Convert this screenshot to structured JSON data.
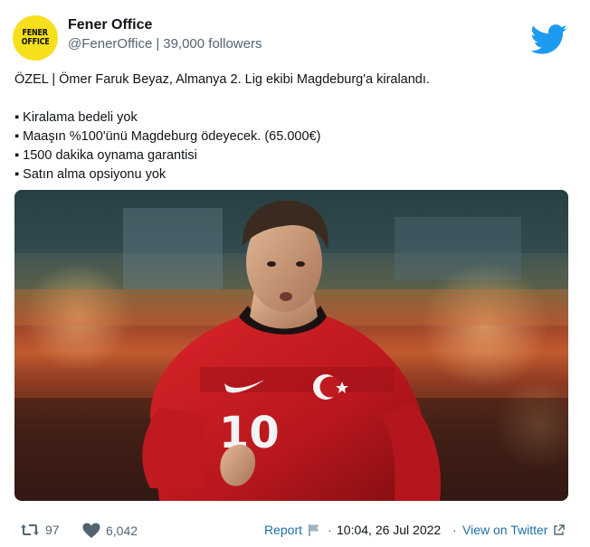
{
  "account": {
    "avatar_text_line1": "FENER",
    "avatar_text_line2": "OFFICE",
    "name": "Fener Office",
    "handle": "@FenerOffice",
    "separator": "|",
    "followers": "39,000 followers"
  },
  "tweet": {
    "headline": "ÖZEL | Ömer Faruk Beyaz, Almanya 2. Lig ekibi Magdeburg'a kiralandı.",
    "bullets": [
      "▪ Kiralama bedeli yok",
      "▪ Maaşın %100'ünü Magdeburg ödeyecek. (65.000€)",
      "▪ 1500 dakika oynama garantisi",
      "▪ Satın alma opsiyonu yok"
    ],
    "jersey_number": "10"
  },
  "footer": {
    "retweets": "97",
    "likes": "6,042",
    "report_label": "Report",
    "separator": "·",
    "timestamp": "10:04, 26 Jul 2022",
    "view_label": "View on Twitter"
  },
  "colors": {
    "accent": "#1d9bf0",
    "link": "#1d6fa5",
    "avatar_bg": "#f6e01c",
    "jersey_red": "#c8181e"
  },
  "icons": {
    "brand": "twitter-bird-icon",
    "retweet": "retweet-icon",
    "like": "heart-icon",
    "report": "flag-icon",
    "external": "external-link-icon"
  }
}
